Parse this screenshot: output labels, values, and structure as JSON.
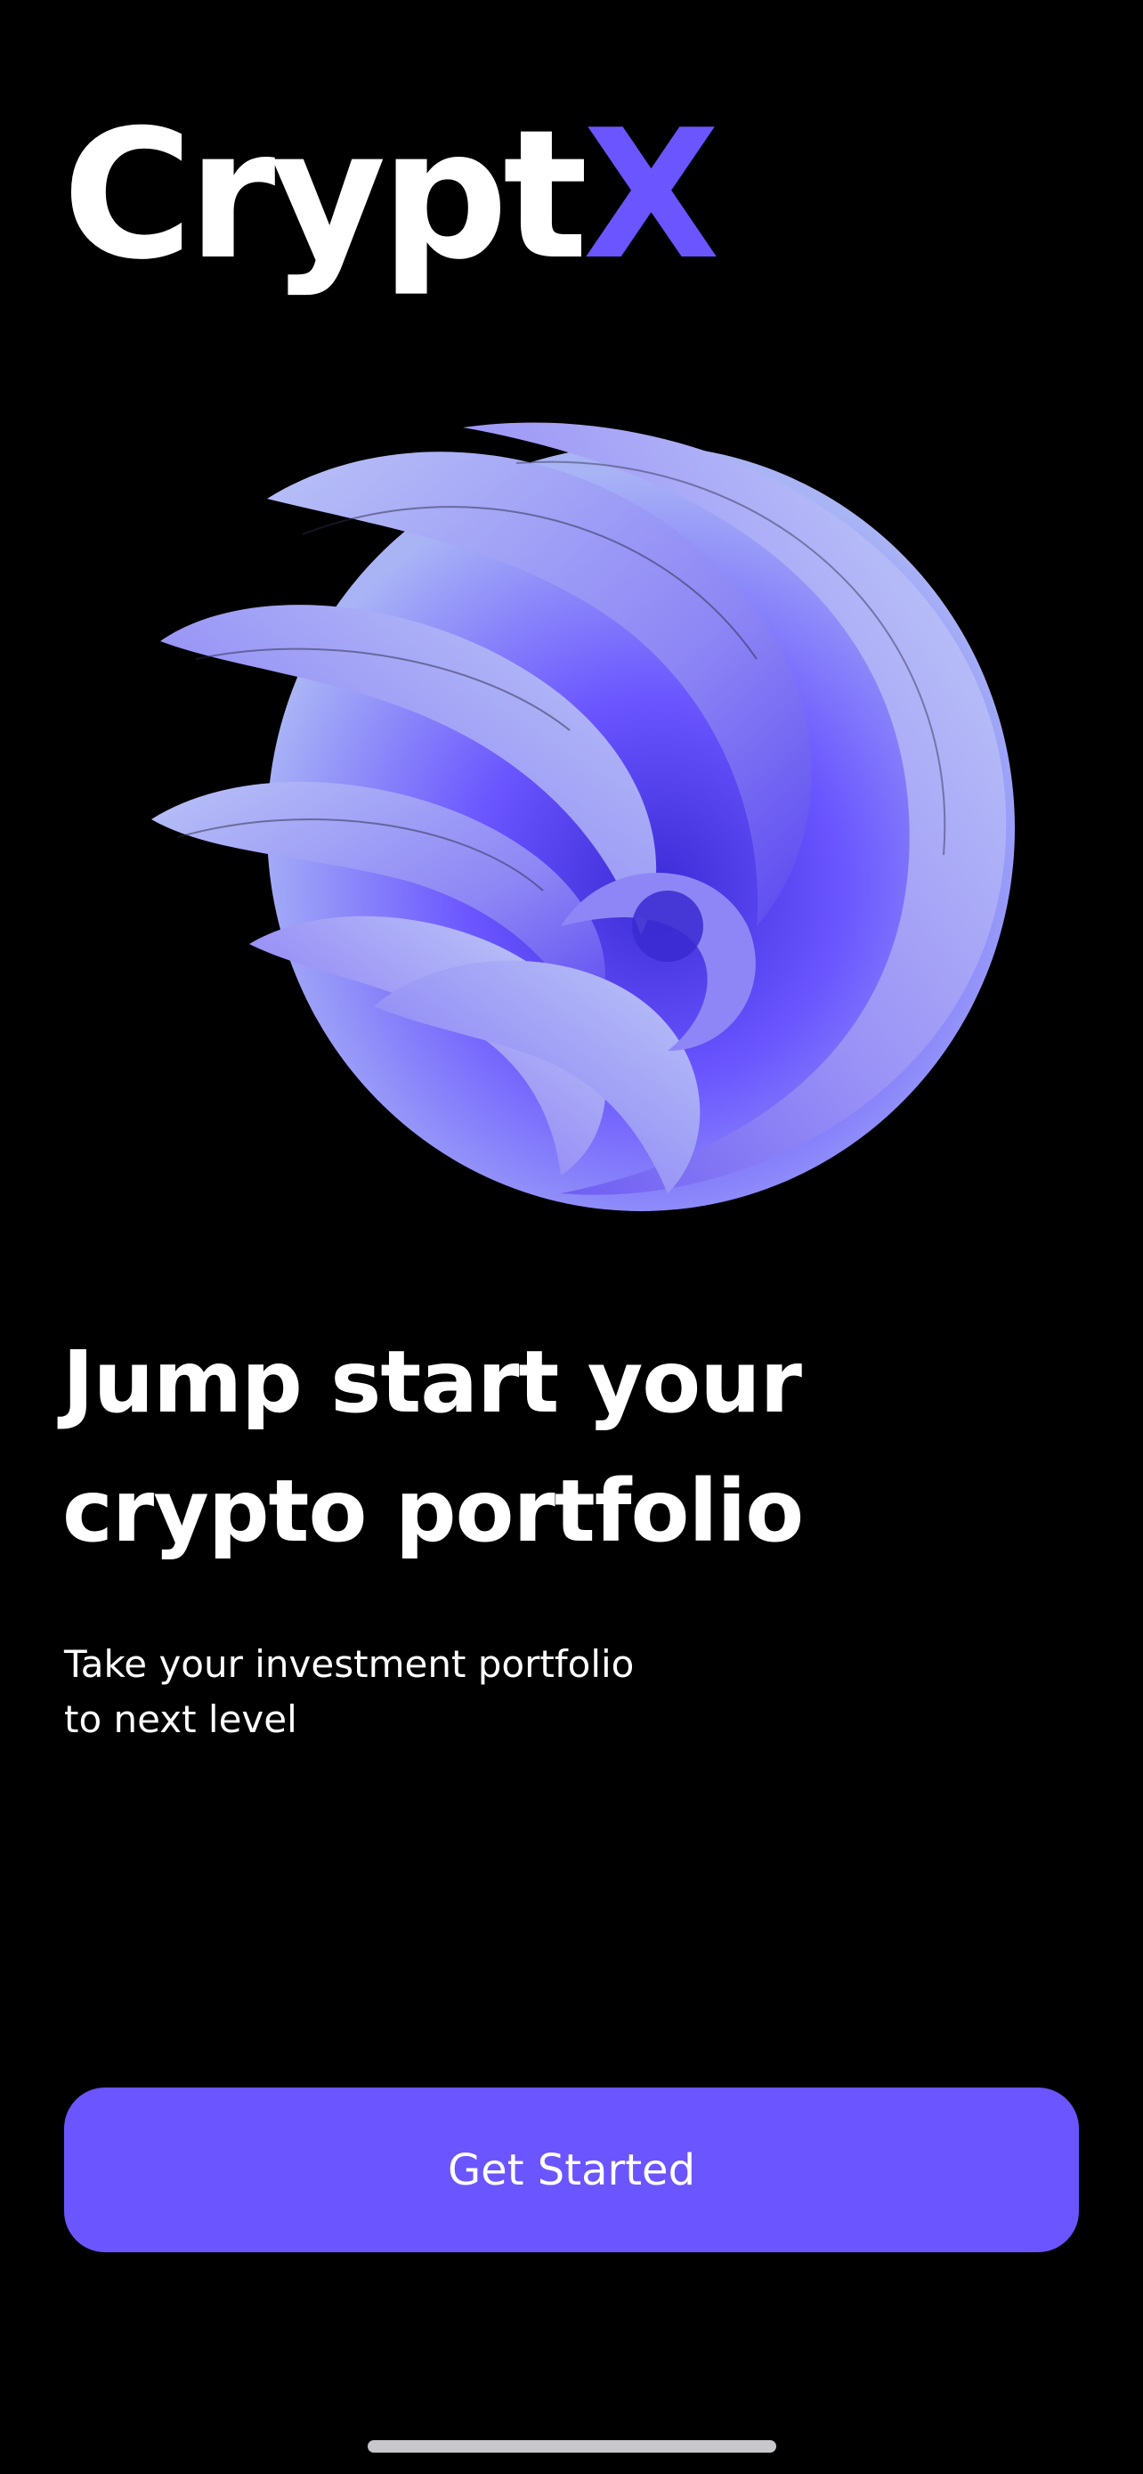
{
  "app": {
    "logo_main": "Crypt",
    "logo_accent": "X"
  },
  "hero": {
    "illustration": "abstract-3d-swirl"
  },
  "onboarding": {
    "headline_line1": "Jump start your",
    "headline_line2": "crypto portfolio",
    "subtitle_line1": "Take your investment portfolio",
    "subtitle_line2": "to next level"
  },
  "actions": {
    "get_started_label": "Get Started"
  },
  "colors": {
    "background": "#000000",
    "accent": "#6a55ff",
    "text": "#ffffff"
  }
}
